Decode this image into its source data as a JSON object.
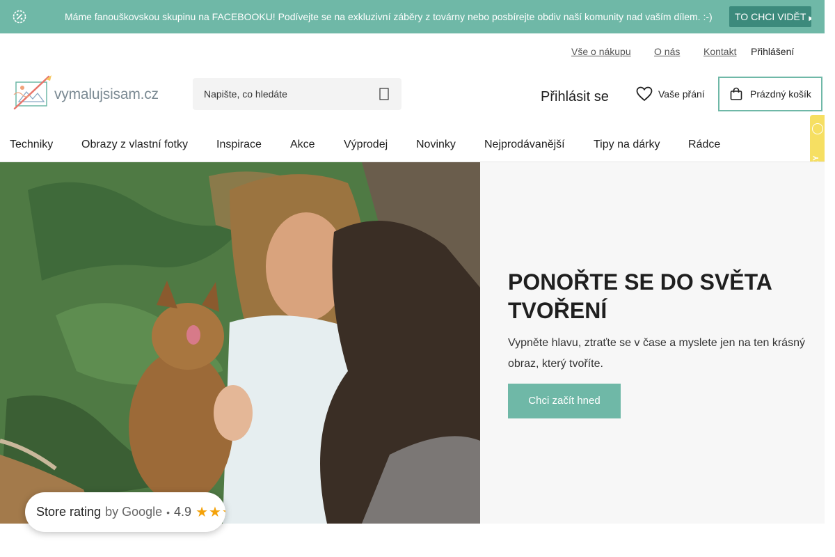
{
  "announcement": {
    "message": "Máme fanouškovskou skupinu na FACEBOOKU! Podívejte se na exkluzivní záběry z továrny nebo posbírejte obdiv naší komunity nad vaším dílem. :-)",
    "cta_label": "TO CHCI VIDĚT",
    "icon": "percent-badge-icon"
  },
  "utility_links": {
    "about_shopping": "Vše o nákupu",
    "about_us": "O nás",
    "contact": "Kontakt",
    "login": "Přihlášení"
  },
  "header": {
    "logo_text": "vymalujsisam.cz",
    "search_placeholder": "Napište, co hledáte",
    "signin_label": "Přihlásit se",
    "wishlist_label": "Vaše přání",
    "cart_label": "Prázdný košík"
  },
  "nav": {
    "items": [
      "Techniky",
      "Obrazy z vlastní fotky",
      "Inspirace",
      "Akce",
      "Výprodej",
      "Novinky",
      "Nejprodávanější",
      "Tipy na dárky",
      "Rádce"
    ]
  },
  "hero": {
    "title": "PONOŘTE SE DO SVĚTA TVOŘENÍ",
    "subtitle": "Vypněte hlavu, ztraťte se v čase a myslete jen na ten krásný obraz, který tvoříte.",
    "button_label": "Chci začít hned"
  },
  "verified_badge": {
    "text": "OVĚŘENO ZÁKAZNÍKY"
  },
  "store_rating": {
    "label": "Store rating",
    "by": "by Google",
    "value": "4.9",
    "stars": "★★★★★"
  },
  "colors": {
    "accent": "#6fb8a7",
    "accent_dark": "#3c8a7c",
    "badge_yellow": "#f6df62",
    "star": "#f4a20a"
  }
}
